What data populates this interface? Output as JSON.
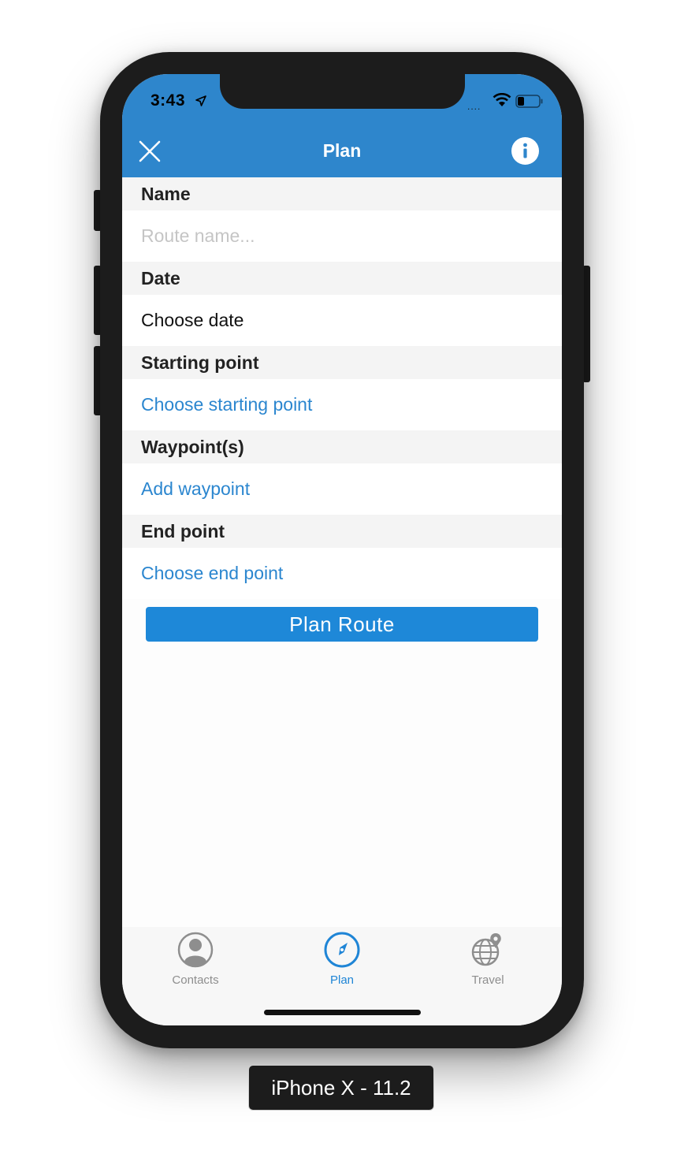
{
  "status_bar": {
    "time": "3:43",
    "signal": "....",
    "icons": [
      "location-arrow-icon",
      "wifi-icon",
      "battery-icon"
    ]
  },
  "nav": {
    "title": "Plan",
    "left_icon": "close-icon",
    "right_icon": "info-icon"
  },
  "form": {
    "name": {
      "header": "Name",
      "placeholder": "Route name..."
    },
    "date": {
      "header": "Date",
      "value": "Choose date"
    },
    "starting_point": {
      "header": "Starting point",
      "action": "Choose starting point"
    },
    "waypoints": {
      "header": "Waypoint(s)",
      "action": "Add waypoint"
    },
    "end_point": {
      "header": "End point",
      "action": "Choose end point"
    }
  },
  "plan_button": "Plan Route",
  "tabs": [
    {
      "label": "Contacts",
      "icon": "contact-person-icon",
      "active": false
    },
    {
      "label": "Plan",
      "icon": "compass-icon",
      "active": true
    },
    {
      "label": "Travel",
      "icon": "globe-location-icon",
      "active": false
    }
  ],
  "device_label": "iPhone X - 11.2",
  "colors": {
    "nav_blue": "#2e86cc",
    "link_blue": "#2b86cf",
    "button_blue": "#1e88d8",
    "tab_inactive": "#8e8e8e",
    "tab_active": "#1f85d6"
  }
}
